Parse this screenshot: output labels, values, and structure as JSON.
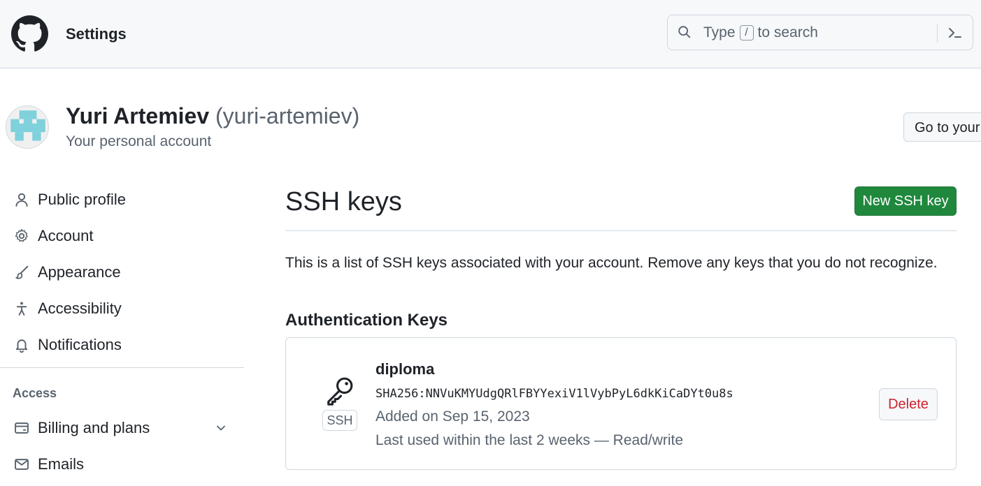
{
  "header": {
    "logo_icon": "github-mark-icon",
    "title": "Settings",
    "search": {
      "icon": "search-icon",
      "prefix": "Type",
      "key": "/",
      "suffix": "to search",
      "command_icon": "command-palette-icon"
    }
  },
  "account": {
    "name": "Yuri Artemiev",
    "handle": "(yuri-artemiev)",
    "subtitle": "Your personal account",
    "goto_label": "Go to your"
  },
  "sidebar": {
    "items": [
      {
        "label": "Public profile",
        "icon": "person-icon"
      },
      {
        "label": "Account",
        "icon": "gear-icon"
      },
      {
        "label": "Appearance",
        "icon": "paintbrush-icon"
      },
      {
        "label": "Accessibility",
        "icon": "accessibility-icon"
      },
      {
        "label": "Notifications",
        "icon": "bell-icon"
      }
    ],
    "access_group": "Access",
    "access_items": [
      {
        "label": "Billing and plans",
        "icon": "credit-card-icon"
      },
      {
        "label": "Emails",
        "icon": "mail-icon"
      }
    ]
  },
  "main": {
    "title": "SSH keys",
    "new_button": "New SSH key",
    "description": "This is a list of SSH keys associated with your account. Remove any keys that you do not recognize.",
    "section_title": "Authentication Keys",
    "keys": [
      {
        "title": "diploma",
        "fingerprint": "SHA256:NNVuKMYUdgQRlFBYYexiV1lVybPyL6dkKiCaDYt0u8s",
        "type_label": "SSH",
        "added": "Added on Sep 15, 2023",
        "last_used": "Last used within the last 2 weeks — Read/write",
        "delete_label": "Delete"
      }
    ]
  },
  "colors": {
    "primary_button": "#1f883d",
    "danger": "#cf222e",
    "muted_text": "#59636e",
    "border": "#d0d7de",
    "avatar_accent": "#7fd1dc"
  }
}
